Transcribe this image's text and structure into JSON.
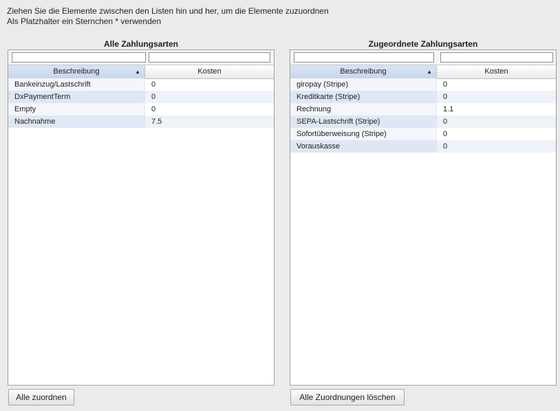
{
  "instructions": {
    "line1": "Ziehen Sie die Elemente zwischen den Listen hin und her, um die Elemente zuzuordnen",
    "line2": "Als Platzhalter ein Sternchen * verwenden"
  },
  "left_panel": {
    "title": "Alle Zahlungsarten",
    "filter_desc_value": "",
    "filter_cost_value": "",
    "col_desc": "Beschreibung",
    "col_cost": "Kosten",
    "rows": [
      {
        "desc": "Bankeinzug/Lastschrift",
        "cost": "0"
      },
      {
        "desc": "DxPaymentTerm",
        "cost": "0"
      },
      {
        "desc": "Empty",
        "cost": "0"
      },
      {
        "desc": "Nachnahme",
        "cost": "7.5"
      }
    ],
    "button": "Alle zuordnen"
  },
  "right_panel": {
    "title": "Zugeordnete Zahlungsarten",
    "filter_desc_value": "",
    "filter_cost_value": "",
    "col_desc": "Beschreibung",
    "col_cost": "Kosten",
    "rows": [
      {
        "desc": "giropay (Stripe)",
        "cost": "0"
      },
      {
        "desc": "Kreditkarte (Stripe)",
        "cost": "0"
      },
      {
        "desc": "Rechnung",
        "cost": "1.1"
      },
      {
        "desc": "SEPA-Lastschrift (Stripe)",
        "cost": "0"
      },
      {
        "desc": "Sofortüberweisung (Stripe)",
        "cost": "0"
      },
      {
        "desc": "Vorauskasse",
        "cost": "0"
      }
    ],
    "button": "Alle Zuordnungen löschen"
  },
  "icons": {
    "sort": "sort-ascending-icon"
  }
}
